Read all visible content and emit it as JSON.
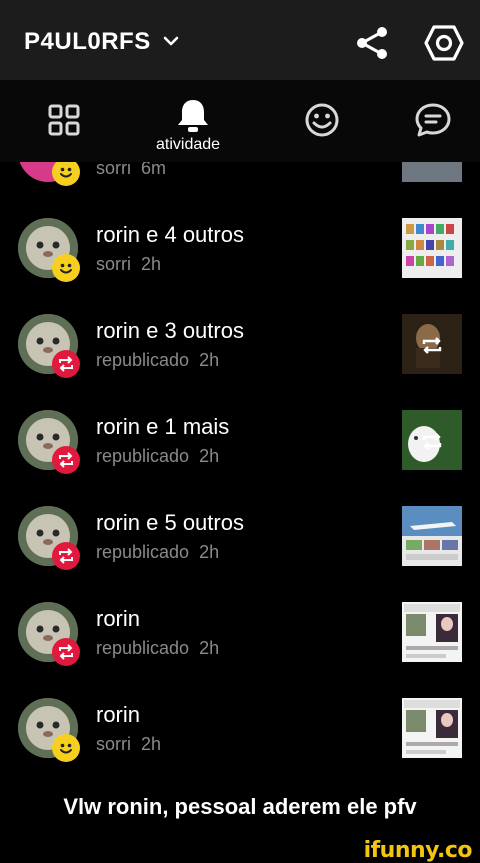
{
  "header": {
    "username": "P4UL0RFS"
  },
  "tabs": {
    "active_label": "atividade"
  },
  "partial_row": {
    "action": "sorri",
    "time": "6m"
  },
  "rows": [
    {
      "name": "rorin",
      "rest": " e 4 outros",
      "action": "sorri",
      "time": "2h",
      "badge": "smile"
    },
    {
      "name": "rorin",
      "rest": " e 3 outros",
      "action": "republicado",
      "time": "2h",
      "badge": "repost"
    },
    {
      "name": "rorin",
      "rest": " e 1 mais",
      "action": "republicado",
      "time": "2h",
      "badge": "repost"
    },
    {
      "name": "rorin",
      "rest": " e 5 outros",
      "action": "republicado",
      "time": "2h",
      "badge": "repost"
    },
    {
      "name": "rorin",
      "rest": "",
      "action": "republicado",
      "time": "2h",
      "badge": "repost"
    },
    {
      "name": "rorin",
      "rest": "",
      "action": "sorri",
      "time": "2h",
      "badge": "smile"
    }
  ],
  "caption": "Vlw ronin, pessoal aderem ele pfv",
  "watermark": "ifunny.co",
  "colors": {
    "smile_badge": "#f7cf1e",
    "repost_badge": "#e2193f",
    "secondary_text": "#8a8a8a"
  }
}
